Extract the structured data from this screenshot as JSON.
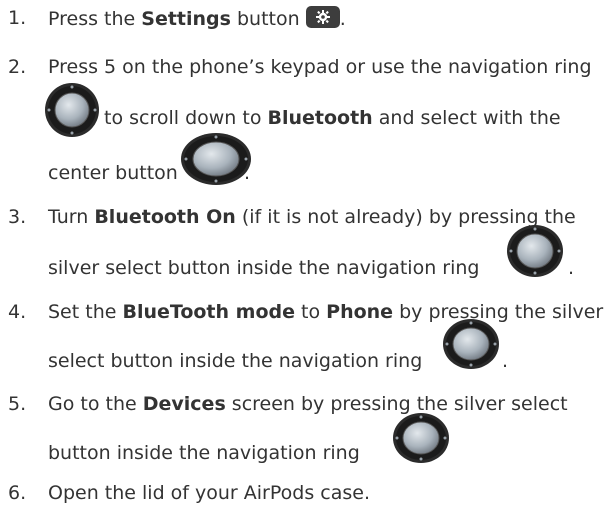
{
  "steps": [
    {
      "num": "1.",
      "t1": "Press the ",
      "b1": "Settings",
      "t2": " button",
      "t3": "."
    },
    {
      "num": "2.",
      "l1": "Press 5 on the phone’s keypad or use the navigation ring",
      "l2a": "to scroll down to ",
      "l2b": "Bluetooth",
      "l2c": " and select with the",
      "l3a": "center button",
      "l3b": "."
    },
    {
      "num": "3.",
      "l1a": "Turn ",
      "l1b": "Bluetooth On",
      "l1c": " (if it is not already) by pressing the",
      "l2a": "silver select button inside the navigation ring",
      "l2b": "."
    },
    {
      "num": "4.",
      "l1a": "Set the ",
      "l1b": "BlueTooth mode",
      "l1c": " to ",
      "l1d": "Phone",
      "l1e": " by pressing the silver",
      "l2a": "select button inside the navigation ring",
      "l2b": "."
    },
    {
      "num": "5.",
      "l1a": "Go to the ",
      "l1b": "Devices",
      "l1c": " screen by pressing the silver select",
      "l2a": "button inside the navigation ring"
    },
    {
      "num": "6.",
      "l1": "Open the lid of your AirPods case."
    }
  ],
  "icons": {
    "settings": "gear-icon",
    "navigation": "navigation-ring-icon"
  },
  "colors": {
    "text": "#333333",
    "settings_button": "#3d3d3d",
    "ring_outer": "#2b2b2b",
    "ring_center": "#b9c3cc"
  }
}
